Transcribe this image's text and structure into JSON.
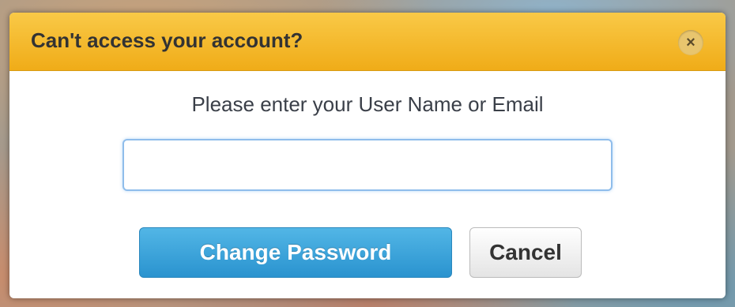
{
  "dialog": {
    "title": "Can't access your account?",
    "close_icon": "close-icon",
    "close_glyph": "×",
    "prompt": "Please enter your User Name or Email",
    "input": {
      "value": "",
      "placeholder": ""
    },
    "buttons": {
      "primary_label": "Change Password",
      "secondary_label": "Cancel"
    }
  },
  "colors": {
    "header_accent": "#f0ac18",
    "primary_button": "#2a93cf",
    "input_focus_border": "#8fbdeb"
  }
}
